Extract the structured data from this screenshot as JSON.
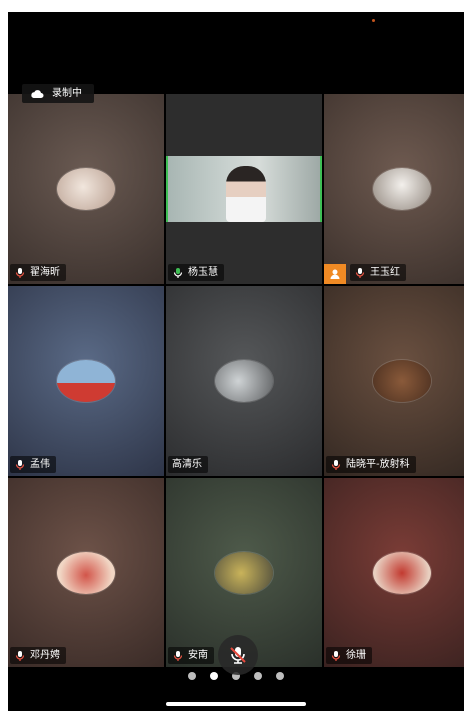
{
  "recording": {
    "label": "录制中"
  },
  "participants": [
    {
      "name": "翟海昕",
      "bg": "#4a3d38"
    },
    {
      "name": "杨玉慧",
      "bg": "#2d2d2d",
      "active": true
    },
    {
      "name": "王玉红",
      "bg": "#4f403a",
      "host": true
    },
    {
      "name": "孟伟",
      "bg": "#3a4358"
    },
    {
      "name": "高清乐",
      "bg": "#353638"
    },
    {
      "name": "陆晓平-放射科",
      "bg": "#3e3530"
    },
    {
      "name": "邓丹娉",
      "bg": "#4a3a36"
    },
    {
      "name": "安南",
      "bg": "#2f3a33"
    },
    {
      "name": "徐珊",
      "bg": "#52302c"
    }
  ],
  "pagination": {
    "pages": 5,
    "current": 2
  },
  "colors": {
    "active_border": "#3fbf55",
    "host_badge": "#f08a24"
  },
  "icons": [
    "cloud-icon",
    "mic-icon",
    "muted-mic-icon",
    "host-user-icon"
  ]
}
